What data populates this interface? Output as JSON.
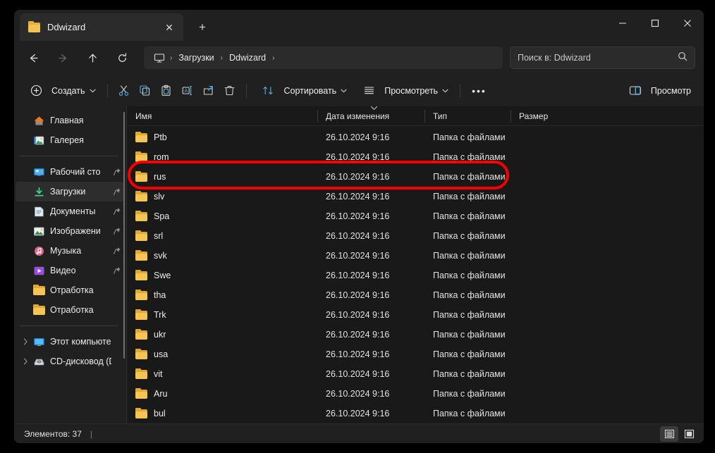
{
  "window": {
    "tab": {
      "title": "Ddwizard",
      "icon": "folder-icon",
      "close_label": "✕",
      "new_tab_label": "+"
    },
    "controls": {
      "minimize": "minimize-icon",
      "maximize": "maximize-icon",
      "close": "close-icon"
    }
  },
  "nav": {
    "back": "back-arrow-icon",
    "forward": "forward-arrow-icon",
    "up": "up-arrow-icon",
    "refresh": "refresh-icon",
    "breadcrumb": {
      "root_icon": "this-pc-icon",
      "items": [
        "Загрузки",
        "Ddwizard"
      ],
      "separator": "›"
    },
    "search": {
      "placeholder": "Поиск в: Ddwizard",
      "value": "",
      "icon": "search-icon"
    }
  },
  "toolbar": {
    "new_label": "Создать",
    "cut_label": "cut-icon",
    "copy_label": "copy-icon",
    "paste_label": "paste-icon",
    "rename_label": "rename-icon",
    "share_label": "share-icon",
    "delete_label": "delete-icon",
    "sort_label": "Сортировать",
    "view_label": "Просмотреть",
    "more_label": "•••",
    "preview_label": "Просмотр",
    "chevron": "⌵",
    "accent_color": "#4cb3e8"
  },
  "sidebar": {
    "items": [
      {
        "label": "Главная",
        "icon": "home-icon",
        "pinned": false,
        "expandable": false,
        "selected": false
      },
      {
        "label": "Галерея",
        "icon": "gallery-icon",
        "pinned": false,
        "expandable": false,
        "selected": false
      },
      {
        "divider": true
      },
      {
        "label": "Рабочий сто",
        "icon": "desktop-icon",
        "pinned": true,
        "expandable": false,
        "selected": false
      },
      {
        "label": "Загрузки",
        "icon": "downloads-icon",
        "pinned": true,
        "expandable": false,
        "selected": true
      },
      {
        "label": "Документы",
        "icon": "documents-icon",
        "pinned": true,
        "expandable": false,
        "selected": false
      },
      {
        "label": "Изображени",
        "icon": "pictures-icon",
        "pinned": true,
        "expandable": false,
        "selected": false
      },
      {
        "label": "Музыка",
        "icon": "music-icon",
        "pinned": true,
        "expandable": false,
        "selected": false
      },
      {
        "label": "Видео",
        "icon": "video-icon",
        "pinned": true,
        "expandable": false,
        "selected": false
      },
      {
        "label": "Отработка",
        "icon": "folder-icon",
        "pinned": false,
        "expandable": false,
        "selected": false
      },
      {
        "label": "Отработка",
        "icon": "folder-icon",
        "pinned": false,
        "expandable": false,
        "selected": false
      },
      {
        "divider": true
      },
      {
        "label": "Этот компьюте",
        "icon": "this-pc-icon",
        "pinned": false,
        "expandable": true,
        "selected": false
      },
      {
        "label": "CD-дисковод (D",
        "icon": "cd-drive-icon",
        "pinned": false,
        "expandable": true,
        "selected": false
      }
    ]
  },
  "filelist": {
    "columns": [
      {
        "key": "name",
        "label": "Имя"
      },
      {
        "key": "date",
        "label": "Дата изменения"
      },
      {
        "key": "type",
        "label": "Тип"
      },
      {
        "key": "size",
        "label": "Размер"
      }
    ],
    "sort_indicator": "⌵",
    "rows": [
      {
        "name": "Ptb",
        "date": "26.10.2024 9:16",
        "type": "Папка с файлами",
        "size": "",
        "icon": "folder-icon",
        "highlighted": false
      },
      {
        "name": "rom",
        "date": "26.10.2024 9:16",
        "type": "Папка с файлами",
        "size": "",
        "icon": "folder-icon",
        "highlighted": false
      },
      {
        "name": "rus",
        "date": "26.10.2024 9:16",
        "type": "Папка с файлами",
        "size": "",
        "icon": "folder-icon",
        "highlighted": true
      },
      {
        "name": "slv",
        "date": "26.10.2024 9:16",
        "type": "Папка с файлами",
        "size": "",
        "icon": "folder-icon",
        "highlighted": false
      },
      {
        "name": "Spa",
        "date": "26.10.2024 9:16",
        "type": "Папка с файлами",
        "size": "",
        "icon": "folder-icon",
        "highlighted": false
      },
      {
        "name": "srl",
        "date": "26.10.2024 9:16",
        "type": "Папка с файлами",
        "size": "",
        "icon": "folder-icon",
        "highlighted": false
      },
      {
        "name": "svk",
        "date": "26.10.2024 9:16",
        "type": "Папка с файлами",
        "size": "",
        "icon": "folder-icon",
        "highlighted": false
      },
      {
        "name": "Swe",
        "date": "26.10.2024 9:16",
        "type": "Папка с файлами",
        "size": "",
        "icon": "folder-icon",
        "highlighted": false
      },
      {
        "name": "tha",
        "date": "26.10.2024 9:16",
        "type": "Папка с файлами",
        "size": "",
        "icon": "folder-icon",
        "highlighted": false
      },
      {
        "name": "Trk",
        "date": "26.10.2024 9:16",
        "type": "Папка с файлами",
        "size": "",
        "icon": "folder-icon",
        "highlighted": false
      },
      {
        "name": "ukr",
        "date": "26.10.2024 9:16",
        "type": "Папка с файлами",
        "size": "",
        "icon": "folder-icon",
        "highlighted": false
      },
      {
        "name": "usa",
        "date": "26.10.2024 9:16",
        "type": "Папка с файлами",
        "size": "",
        "icon": "folder-icon",
        "highlighted": false
      },
      {
        "name": "vit",
        "date": "26.10.2024 9:16",
        "type": "Папка с файлами",
        "size": "",
        "icon": "folder-icon",
        "highlighted": false
      },
      {
        "name": "Aru",
        "date": "26.10.2024 9:16",
        "type": "Папка с файлами",
        "size": "",
        "icon": "folder-icon",
        "highlighted": false
      },
      {
        "name": "bul",
        "date": "26.10.2024 9:16",
        "type": "Папка с файлами",
        "size": "",
        "icon": "folder-icon",
        "highlighted": false
      }
    ]
  },
  "statusbar": {
    "count_text": "Элементов: 37",
    "separator": "|",
    "views": [
      {
        "name": "details-view",
        "active": true
      },
      {
        "name": "large-icons-view",
        "active": false
      }
    ]
  },
  "annotation": {
    "color": "#f80000",
    "target_row": "rus"
  }
}
